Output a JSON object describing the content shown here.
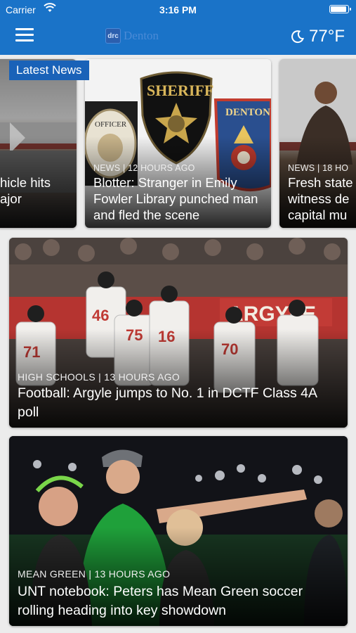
{
  "status_bar": {
    "carrier": "Carrier",
    "time": "3:16 PM"
  },
  "header": {
    "logo_badge": "drc",
    "logo_text": "Denton",
    "temperature": "77°F",
    "weather_icon": "moon-icon",
    "menu_icon": "hamburger-menu-icon"
  },
  "latest": {
    "label": "Latest News",
    "cards": [
      {
        "meta": "",
        "title": "hicle hits\najor"
      },
      {
        "meta": "NEWS | 12 HOURS AGO",
        "title": "Blotter: Stranger in Emily Fowler Library punched man and fled the scene",
        "badge_texts": [
          "SHERIFF",
          "DENTON",
          "OFFICER"
        ]
      },
      {
        "meta": "NEWS | 18 HO",
        "title": "Fresh state\nwitness de\ncapital mu"
      }
    ]
  },
  "stories": [
    {
      "meta": "HIGH SCHOOLS | 13 HOURS AGO",
      "title": "Football: Argyle jumps to No. 1 in DCTF Class 4A poll",
      "banner": "ARGYLE"
    },
    {
      "meta": "MEAN GREEN | 13 HOURS AGO",
      "title": "UNT notebook: Peters has Mean Green soccer rolling heading into key showdown"
    }
  ],
  "colors": {
    "brand_blue": "#1a73c8",
    "label_blue": "#1a62b8"
  }
}
